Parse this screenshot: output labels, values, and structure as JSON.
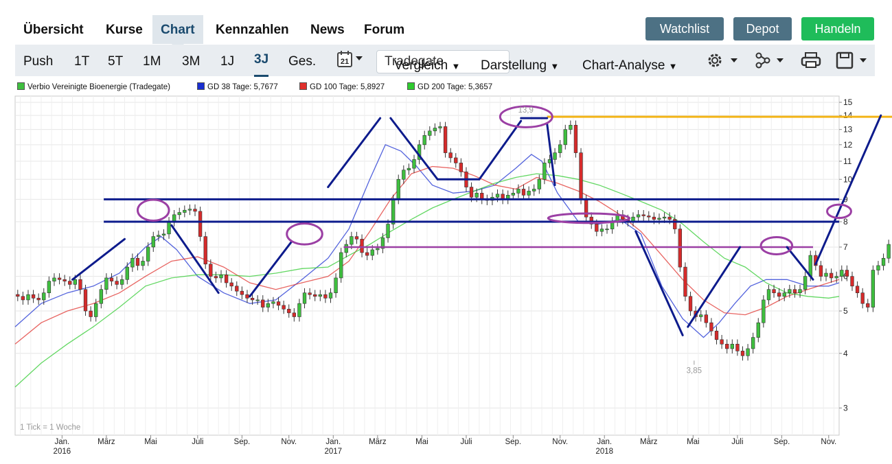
{
  "nav": {
    "tabs": [
      {
        "label": "Übersicht"
      },
      {
        "label": "Kurse"
      },
      {
        "label": "Chart",
        "active": true
      },
      {
        "label": "Kennzahlen"
      },
      {
        "label": "News"
      },
      {
        "label": "Forum"
      }
    ],
    "buttons": {
      "watchlist": "Watchlist",
      "depot": "Depot",
      "handeln": "Handeln"
    }
  },
  "toolbar": {
    "ranges": [
      "Push",
      "1T",
      "5T",
      "1M",
      "3M",
      "1J",
      "3J",
      "Ges."
    ],
    "active_range": "3J",
    "calendar_day": "21",
    "exchange": "Tradegate",
    "menus": {
      "vergleich": "Vergleich",
      "darstellung": "Darstellung",
      "analyse": "Chart-Analyse"
    },
    "icons": [
      "calendar-icon",
      "gear-icon",
      "network-icon",
      "print-icon",
      "save-icon"
    ]
  },
  "colors": {
    "up": "#3fbf3f",
    "down": "#d62b2b",
    "gd38": "#1a2fd1",
    "gd100": "#e0302c",
    "gd200": "#2fcb2f",
    "trend": "#0d1b8c",
    "violet": "#9b3fa4",
    "resistance": "#f3b417"
  },
  "chart_data": {
    "type": "candlestick",
    "title": "",
    "legend": [
      {
        "label": "Verbio Vereinigte Bioenergie (Tradegate)",
        "color": "#3fbf3f"
      },
      {
        "label": "GD 38 Tage: 5,7677",
        "color": "#1a2fd1"
      },
      {
        "label": "GD 100 Tage: 5,8927",
        "color": "#e0302c"
      },
      {
        "label": "GD 200 Tage: 5,3657",
        "color": "#2fcb2f"
      }
    ],
    "yscale": "log",
    "ylim": [
      2.6,
      15.5
    ],
    "yticks": [
      3,
      4,
      5,
      6,
      7,
      8,
      9,
      10,
      11,
      12,
      13,
      14,
      15
    ],
    "xlim": [
      0,
      158
    ],
    "xticks": [
      {
        "x": 9,
        "label": "Jan.",
        "year": "2016"
      },
      {
        "x": 17.5,
        "label": "März"
      },
      {
        "x": 26,
        "label": "Mai"
      },
      {
        "x": 35,
        "label": "Juli"
      },
      {
        "x": 43.5,
        "label": "Sep."
      },
      {
        "x": 52.5,
        "label": "Nov."
      },
      {
        "x": 61,
        "label": "Jan.",
        "year": "2017"
      },
      {
        "x": 69.5,
        "label": "März"
      },
      {
        "x": 78,
        "label": "Mai"
      },
      {
        "x": 86.5,
        "label": "Juli"
      },
      {
        "x": 95.5,
        "label": "Sep."
      },
      {
        "x": 104.5,
        "label": "Nov."
      },
      {
        "x": 113,
        "label": "Jan.",
        "year": "2018"
      },
      {
        "x": 121.5,
        "label": "März"
      },
      {
        "x": 130,
        "label": "Mai"
      },
      {
        "x": 138.5,
        "label": "Juli"
      },
      {
        "x": 147,
        "label": "Sep."
      },
      {
        "x": 156,
        "label": "Nov."
      }
    ],
    "annotations": {
      "high": {
        "label": "13,9",
        "x": 99.5,
        "value": 13.9
      },
      "low": {
        "label": "3,85",
        "x": 130.2,
        "value": 3.85
      },
      "tick_note": "1 Tick = 1 Woche"
    },
    "close_series": [
      5.4,
      5.3,
      5.45,
      5.35,
      5.3,
      5.5,
      5.85,
      5.95,
      5.9,
      5.85,
      5.75,
      5.9,
      5.6,
      5.0,
      4.85,
      5.2,
      5.6,
      5.95,
      5.85,
      5.75,
      5.9,
      6.3,
      6.6,
      6.35,
      6.5,
      7.0,
      7.4,
      7.45,
      7.5,
      8.0,
      8.3,
      8.4,
      8.5,
      8.55,
      8.45,
      7.4,
      6.4,
      6.0,
      5.95,
      6.05,
      5.8,
      5.7,
      5.55,
      5.45,
      5.35,
      5.3,
      5.3,
      5.1,
      5.2,
      5.25,
      5.15,
      5.05,
      4.95,
      4.85,
      5.2,
      5.5,
      5.45,
      5.4,
      5.45,
      5.35,
      5.5,
      5.95,
      6.8,
      7.1,
      7.4,
      7.3,
      6.8,
      6.7,
      6.9,
      6.95,
      7.35,
      7.9,
      9.0,
      10.0,
      10.5,
      10.6,
      11.1,
      12.0,
      12.6,
      12.9,
      13.1,
      13.2,
      11.5,
      11.2,
      10.9,
      10.4,
      9.6,
      9.1,
      9.3,
      9.0,
      8.95,
      9.1,
      9.25,
      9.0,
      9.2,
      9.3,
      9.5,
      9.2,
      9.4,
      9.5,
      10.0,
      10.9,
      11.1,
      11.5,
      12.0,
      13.0,
      13.3,
      11.5,
      9.0,
      8.2,
      7.9,
      7.6,
      7.7,
      7.7,
      8.0,
      8.3,
      8.1,
      8.0,
      8.2,
      8.3,
      8.25,
      8.2,
      8.1,
      8.15,
      8.2,
      8.1,
      7.7,
      6.3,
      5.4,
      5.0,
      4.85,
      4.9,
      4.7,
      4.5,
      4.3,
      4.2,
      4.1,
      4.2,
      4.05,
      3.95,
      4.1,
      4.35,
      4.7,
      5.3,
      5.6,
      5.5,
      5.4,
      5.5,
      5.6,
      5.5,
      5.6,
      6.0,
      6.7,
      6.35,
      6.0,
      6.1,
      5.95,
      6.0,
      6.2,
      6.0,
      5.7,
      5.5,
      5.2,
      5.1,
      6.2,
      6.35,
      6.6,
      7.1
    ],
    "moving_averages": {
      "gd38": [
        [
          0,
          4.6
        ],
        [
          5,
          5.2
        ],
        [
          10,
          5.5
        ],
        [
          15,
          5.7
        ],
        [
          20,
          6.1
        ],
        [
          25,
          7.0
        ],
        [
          28,
          7.4
        ],
        [
          31,
          6.9
        ],
        [
          35,
          6.0
        ],
        [
          40,
          5.5
        ],
        [
          45,
          5.2
        ],
        [
          50,
          5.3
        ],
        [
          55,
          5.9
        ],
        [
          60,
          6.6
        ],
        [
          64,
          7.7
        ],
        [
          68,
          10.0
        ],
        [
          71,
          12.0
        ],
        [
          74,
          11.6
        ],
        [
          77,
          10.7
        ],
        [
          80,
          9.7
        ],
        [
          84,
          9.3
        ],
        [
          88,
          9.4
        ],
        [
          92,
          9.7
        ],
        [
          96,
          10.6
        ],
        [
          99,
          11.4
        ],
        [
          101,
          11.0
        ],
        [
          104,
          9.3
        ],
        [
          108,
          8.0
        ],
        [
          112,
          7.9
        ],
        [
          116,
          8.1
        ],
        [
          120,
          7.5
        ],
        [
          124,
          5.7
        ],
        [
          128,
          4.8
        ],
        [
          132,
          4.35
        ],
        [
          135,
          4.7
        ],
        [
          138,
          5.2
        ],
        [
          141,
          5.7
        ],
        [
          144,
          5.9
        ],
        [
          148,
          5.9
        ],
        [
          152,
          5.7
        ],
        [
          156,
          5.7
        ],
        [
          158,
          5.8
        ]
      ],
      "gd100": [
        [
          0,
          4.2
        ],
        [
          5,
          4.7
        ],
        [
          10,
          5.0
        ],
        [
          15,
          5.2
        ],
        [
          20,
          5.5
        ],
        [
          25,
          6.0
        ],
        [
          30,
          6.5
        ],
        [
          35,
          6.65
        ],
        [
          40,
          6.3
        ],
        [
          45,
          5.8
        ],
        [
          50,
          5.6
        ],
        [
          55,
          5.8
        ],
        [
          60,
          6.0
        ],
        [
          64,
          6.5
        ],
        [
          68,
          7.6
        ],
        [
          72,
          9.0
        ],
        [
          76,
          10.3
        ],
        [
          80,
          10.7
        ],
        [
          84,
          10.6
        ],
        [
          88,
          10.2
        ],
        [
          92,
          9.7
        ],
        [
          96,
          9.5
        ],
        [
          100,
          10.1
        ],
        [
          104,
          9.8
        ],
        [
          108,
          9.4
        ],
        [
          112,
          8.9
        ],
        [
          116,
          8.3
        ],
        [
          120,
          7.6
        ],
        [
          124,
          6.7
        ],
        [
          128,
          5.9
        ],
        [
          132,
          5.3
        ],
        [
          136,
          4.95
        ],
        [
          140,
          4.9
        ],
        [
          144,
          5.1
        ],
        [
          148,
          5.4
        ],
        [
          152,
          5.6
        ],
        [
          156,
          5.8
        ],
        [
          158,
          5.9
        ]
      ],
      "gd200": [
        [
          0,
          3.35
        ],
        [
          5,
          3.8
        ],
        [
          10,
          4.2
        ],
        [
          15,
          4.6
        ],
        [
          20,
          5.1
        ],
        [
          25,
          5.7
        ],
        [
          30,
          5.95
        ],
        [
          35,
          6.05
        ],
        [
          40,
          6.05
        ],
        [
          45,
          6.0
        ],
        [
          50,
          6.1
        ],
        [
          55,
          6.25
        ],
        [
          60,
          6.3
        ],
        [
          64,
          6.7
        ],
        [
          68,
          7.1
        ],
        [
          72,
          7.6
        ],
        [
          76,
          8.1
        ],
        [
          80,
          8.6
        ],
        [
          84,
          9.0
        ],
        [
          88,
          9.4
        ],
        [
          92,
          9.8
        ],
        [
          96,
          10.1
        ],
        [
          100,
          10.3
        ],
        [
          104,
          10.2
        ],
        [
          108,
          10.0
        ],
        [
          112,
          9.7
        ],
        [
          116,
          9.3
        ],
        [
          120,
          8.9
        ],
        [
          124,
          8.5
        ],
        [
          128,
          7.9
        ],
        [
          132,
          7.2
        ],
        [
          136,
          6.6
        ],
        [
          140,
          6.3
        ],
        [
          144,
          5.8
        ],
        [
          148,
          5.5
        ],
        [
          152,
          5.4
        ],
        [
          156,
          5.35
        ],
        [
          158,
          5.4
        ]
      ]
    },
    "drawings": {
      "horizontal_levels": [
        {
          "kind": "support",
          "value": 9.0,
          "from": 17,
          "to": 158
        },
        {
          "kind": "support",
          "value": 8.0,
          "from": 17,
          "to": 158
        },
        {
          "kind": "violet",
          "value": 7.0,
          "from": 63,
          "to": 153
        },
        {
          "kind": "resistance",
          "value": 13.9,
          "from": 102,
          "to": 158
        }
      ],
      "trend_lines": [
        [
          [
            11,
            5.9
          ],
          [
            21,
            7.3
          ]
        ],
        [
          [
            30,
            7.85
          ],
          [
            39,
            5.5
          ]
        ],
        [
          [
            45,
            5.4
          ],
          [
            53,
            7.2
          ]
        ],
        [
          [
            60,
            9.6
          ],
          [
            70,
            13.8
          ]
        ],
        [
          [
            72,
            13.8
          ],
          [
            81,
            10.0
          ]
        ],
        [
          [
            81,
            10.0
          ],
          [
            89,
            10.0
          ]
        ],
        [
          [
            89,
            10.0
          ],
          [
            97,
            13.6
          ]
        ],
        [
          [
            97,
            13.8
          ],
          [
            102,
            13.8
          ]
        ],
        [
          [
            102,
            13.4
          ],
          [
            103.5,
            9.7
          ]
        ],
        [
          [
            119,
            7.6
          ],
          [
            128,
            4.4
          ]
        ],
        [
          [
            129,
            4.6
          ],
          [
            139,
            7.0
          ]
        ],
        [
          [
            148,
            7.0
          ],
          [
            153,
            5.9
          ]
        ],
        [
          [
            153.5,
            6.4
          ],
          [
            166,
            14.0
          ]
        ]
      ],
      "ellipses": [
        {
          "x": 26.5,
          "y": 8.5,
          "rx": 3,
          "ry": 0.055
        },
        {
          "x": 55.5,
          "y": 7.5,
          "rx": 3.4,
          "ry": 0.055
        },
        {
          "x": 98,
          "y": 13.9,
          "rx": 5,
          "ry": 0.055
        },
        {
          "x": 110,
          "y": 8.15,
          "rx": 7.8,
          "ry": 0.025
        },
        {
          "x": 146,
          "y": 7.05,
          "rx": 3,
          "ry": 0.045
        },
        {
          "x": 158,
          "y": 8.45,
          "rx": 2.3,
          "ry": 0.035
        }
      ]
    }
  }
}
